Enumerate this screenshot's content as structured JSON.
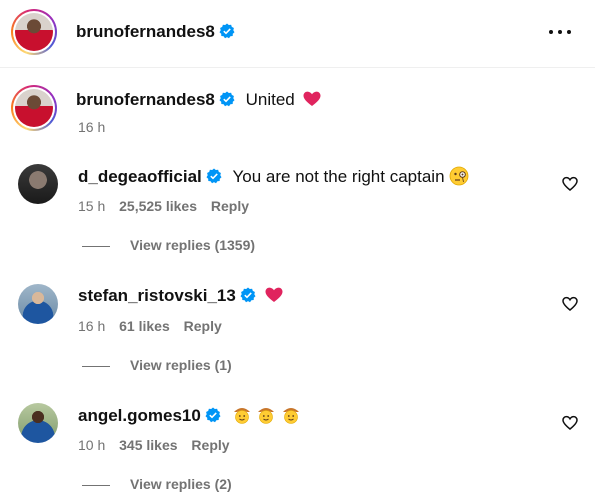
{
  "post": {
    "author": "brunofernandes8",
    "caption_text": "United",
    "caption_time": "16 h"
  },
  "comments": [
    {
      "username": "d_degeaofficial",
      "text": "You are not the right captain",
      "emoji": "face-with-monocle",
      "time": "15 h",
      "likes": "25,525 likes",
      "reply": "Reply",
      "view_replies": "View replies (1359)"
    },
    {
      "username": "stefan_ristovski_13",
      "text": "",
      "emoji": "red-heart",
      "time": "16 h",
      "likes": "61 likes",
      "reply": "Reply",
      "view_replies": "View replies (1)"
    },
    {
      "username": "angel.gomes10",
      "text": "",
      "emoji": "cowboy-face x3",
      "time": "10 h",
      "likes": "345 likes",
      "reply": "Reply",
      "view_replies": "View replies (2)"
    }
  ],
  "colors": {
    "verified_blue": "#0095f6",
    "secondary_text": "#737373",
    "heart_red": "#e0245e"
  }
}
